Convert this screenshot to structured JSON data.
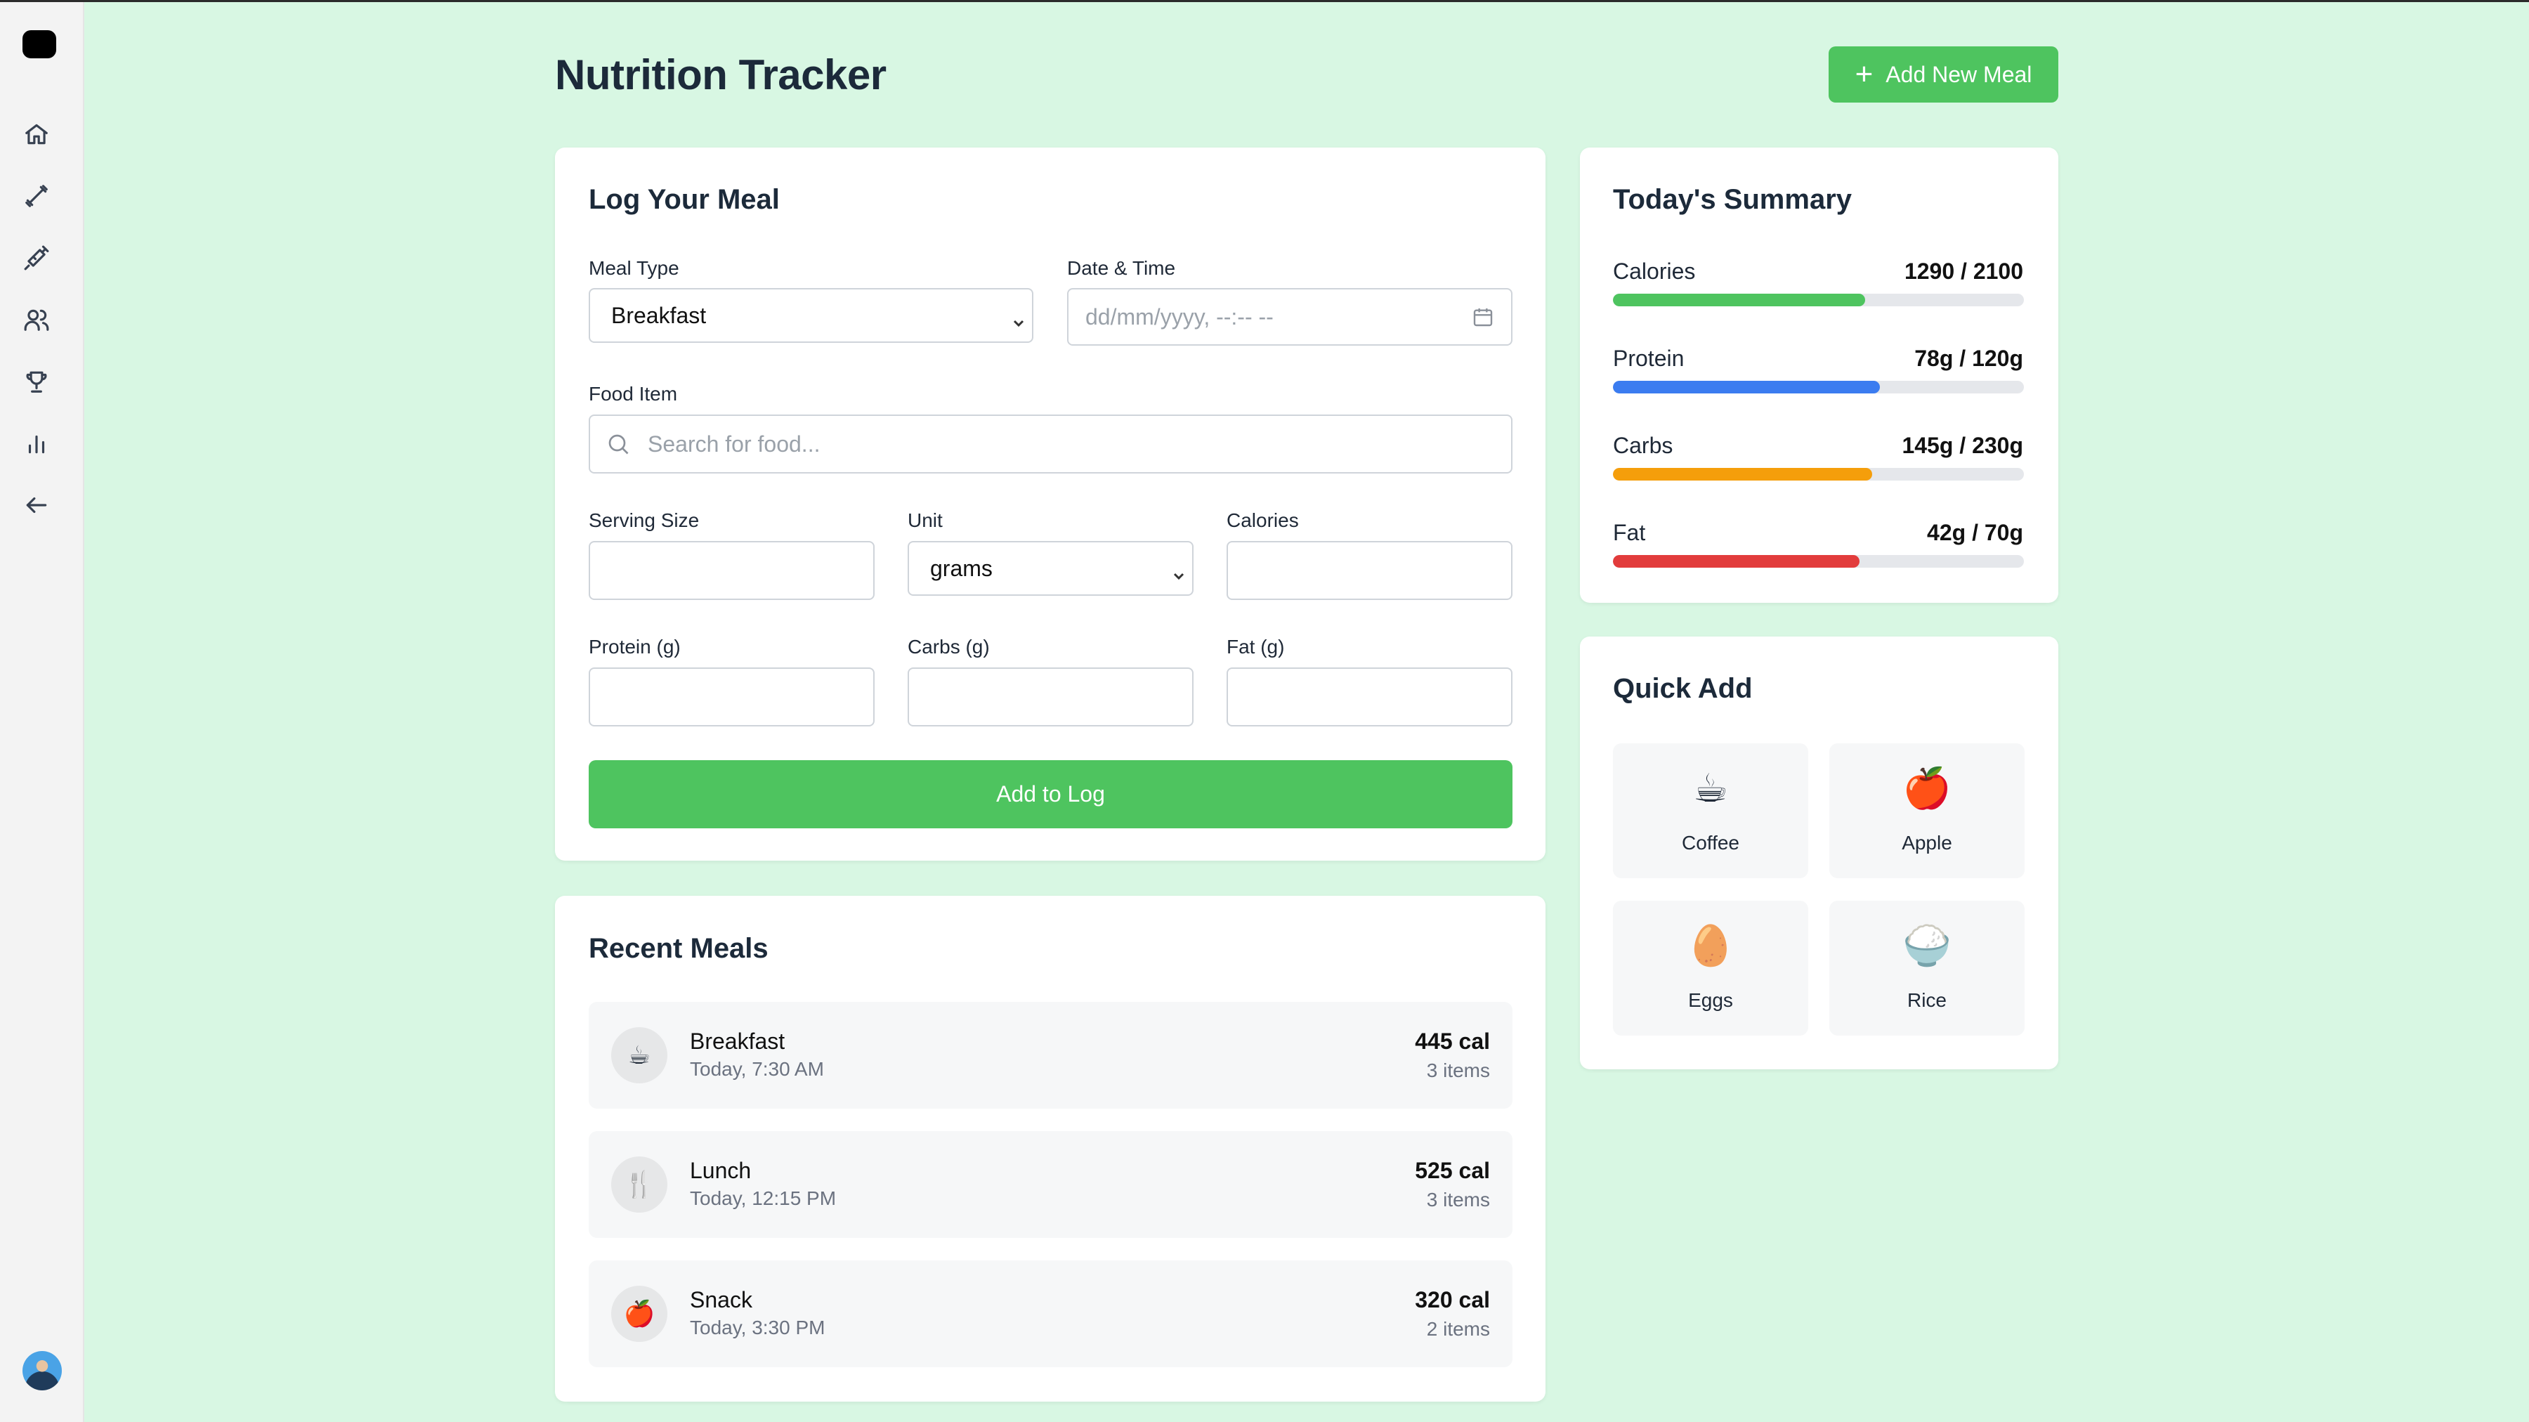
{
  "header": {
    "title": "Nutrition Tracker",
    "add_button": "Add New Meal"
  },
  "sidebar": {
    "icons": [
      "home-icon",
      "dumbbell-icon",
      "syringe-icon",
      "users-icon",
      "trophy-icon",
      "bar-chart-icon",
      "back-arrow-icon"
    ]
  },
  "log_form": {
    "title": "Log Your Meal",
    "meal_type_label": "Meal Type",
    "meal_type_value": "Breakfast",
    "datetime_label": "Date & Time",
    "datetime_placeholder": "dd/mm/yyyy, --:-- --",
    "food_label": "Food Item",
    "food_placeholder": "Search for food...",
    "serving_label": "Serving Size",
    "unit_label": "Unit",
    "unit_value": "grams",
    "calories_label": "Calories",
    "protein_label": "Protein (g)",
    "carbs_label": "Carbs (g)",
    "fat_label": "Fat (g)",
    "submit_label": "Add to Log"
  },
  "recent": {
    "title": "Recent Meals",
    "meals": [
      {
        "icon": "☕",
        "name": "Breakfast",
        "time": "Today, 7:30 AM",
        "calories": "445 cal",
        "items": "3 items"
      },
      {
        "icon": "🍴",
        "name": "Lunch",
        "time": "Today, 12:15 PM",
        "calories": "525 cal",
        "items": "3 items"
      },
      {
        "icon": "🍎",
        "name": "Snack",
        "time": "Today, 3:30 PM",
        "calories": "320 cal",
        "items": "2 items"
      }
    ]
  },
  "summary": {
    "title": "Today's Summary",
    "rows": [
      {
        "label": "Calories",
        "value": "1290 / 2100",
        "progress": 0.614,
        "color": "#4ec45f"
      },
      {
        "label": "Protein",
        "value": "78g / 120g",
        "progress": 0.65,
        "color": "#3b7cf0"
      },
      {
        "label": "Carbs",
        "value": "145g / 230g",
        "progress": 0.63,
        "color": "#f59e0b"
      },
      {
        "label": "Fat",
        "value": "42g / 70g",
        "progress": 0.6,
        "color": "#e23c3c"
      }
    ]
  },
  "quick_add": {
    "title": "Quick Add",
    "items": [
      {
        "emoji": "☕",
        "label": "Coffee"
      },
      {
        "emoji": "🍎",
        "label": "Apple"
      },
      {
        "emoji": "🥚",
        "label": "Eggs"
      },
      {
        "emoji": "🍚",
        "label": "Rice"
      }
    ]
  }
}
